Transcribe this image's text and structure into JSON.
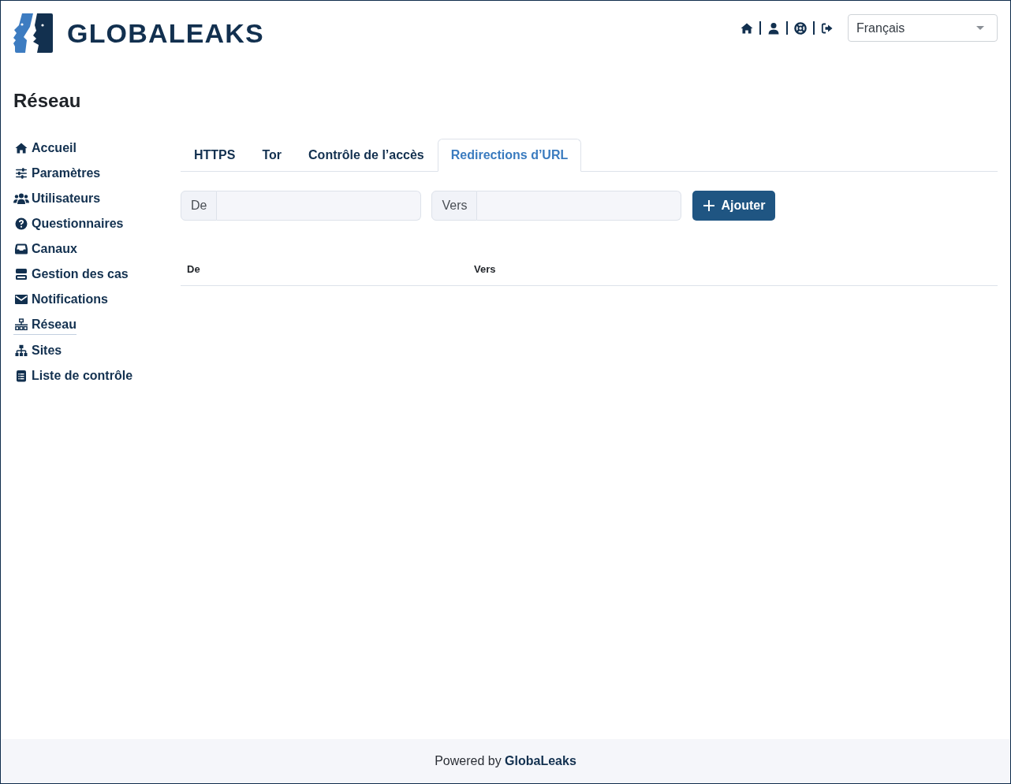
{
  "header": {
    "logo_text": "GLOBALEAKS",
    "language_select": {
      "value": "Français"
    }
  },
  "page_title": "Réseau",
  "sidebar": {
    "items": [
      {
        "label": "Accueil",
        "selected": false
      },
      {
        "label": "Paramètres",
        "selected": false
      },
      {
        "label": "Utilisateurs",
        "selected": false
      },
      {
        "label": "Questionnaires",
        "selected": false
      },
      {
        "label": "Canaux",
        "selected": false
      },
      {
        "label": "Gestion des cas",
        "selected": false
      },
      {
        "label": "Notifications",
        "selected": false
      },
      {
        "label": "Réseau",
        "selected": true
      },
      {
        "label": "Sites",
        "selected": false
      },
      {
        "label": "Liste de contrôle",
        "selected": false
      }
    ]
  },
  "tabs": [
    {
      "label": "HTTPS",
      "selected": false
    },
    {
      "label": "Tor",
      "selected": false
    },
    {
      "label": "Contrôle de l’accès",
      "selected": false
    },
    {
      "label": "Redirections d’URL",
      "selected": true
    }
  ],
  "redirect_form": {
    "fields": [
      {
        "label": "De"
      },
      {
        "label": "Vers"
      }
    ],
    "add_button": {
      "label": "Ajouter"
    }
  },
  "table": {
    "columns": [
      "De",
      "Vers"
    ]
  },
  "footer": {
    "text": "Powered by **GlobaLeaks**"
  }
}
